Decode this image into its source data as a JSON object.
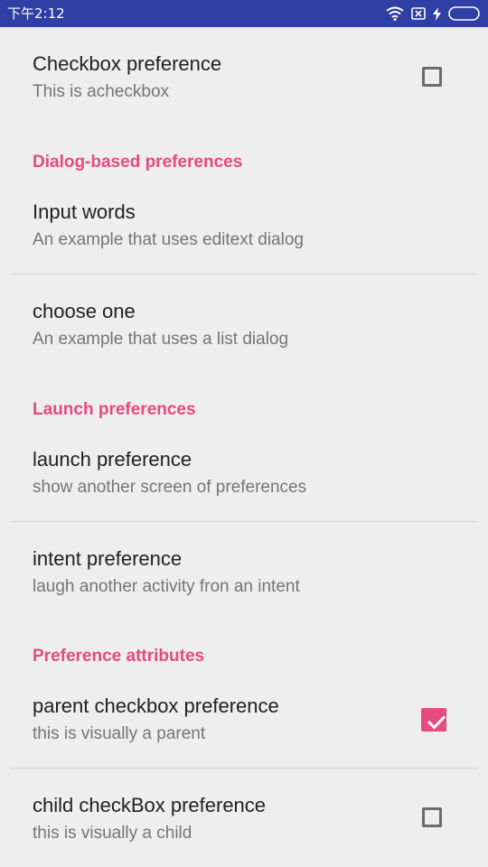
{
  "status_bar": {
    "time": "下午2:12",
    "icons": [
      "wifi-icon",
      "sim-icon",
      "charging-icon",
      "battery-icon"
    ]
  },
  "prefs": {
    "checkbox_pref": {
      "title": "Checkbox preference",
      "summary": "This is acheckbox",
      "checked": false
    },
    "input_words": {
      "title": "Input words",
      "summary": "An example that uses editext dialog"
    },
    "choose_one": {
      "title": "choose one",
      "summary": "An example that uses a list dialog"
    },
    "launch_pref": {
      "title": "launch preference",
      "summary": "show another screen of preferences"
    },
    "intent_pref": {
      "title": "intent preference",
      "summary": "laugh another activity fron an intent"
    },
    "parent_checkbox": {
      "title": "parent checkbox preference",
      "summary": "this is visually a parent",
      "checked": true
    },
    "child_checkbox": {
      "title": "child checkBox preference",
      "summary": "this is visually a child",
      "checked": false
    }
  },
  "categories": {
    "dialog": "Dialog-based preferences",
    "launch": "Launch preferences",
    "attributes": "Preference attributes"
  },
  "colors": {
    "accent": "#e8497f",
    "status_bar": "#2f3fa3",
    "background": "#eeeeee"
  }
}
